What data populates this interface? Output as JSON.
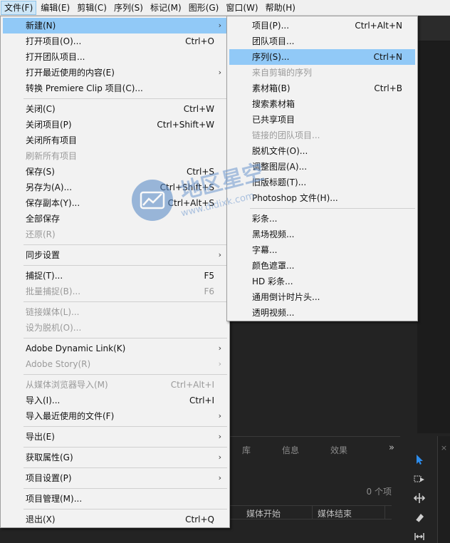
{
  "menubar": {
    "items": [
      "文件(F)",
      "编辑(E)",
      "剪辑(C)",
      "序列(S)",
      "标记(M)",
      "图形(G)",
      "窗口(W)",
      "帮助(H)"
    ]
  },
  "file_menu": {
    "items": [
      {
        "label": "新建(N)",
        "shortcut": ""
      },
      {
        "label": "打开项目(O)...",
        "shortcut": "Ctrl+O"
      },
      {
        "label": "打开团队项目...",
        "shortcut": ""
      },
      {
        "label": "打开最近使用的内容(E)",
        "shortcut": ""
      },
      {
        "label": "转换 Premiere Clip 项目(C)...",
        "shortcut": ""
      },
      {
        "label": "关闭(C)",
        "shortcut": "Ctrl+W"
      },
      {
        "label": "关闭项目(P)",
        "shortcut": "Ctrl+Shift+W"
      },
      {
        "label": "关闭所有项目",
        "shortcut": ""
      },
      {
        "label": "刷新所有项目",
        "shortcut": ""
      },
      {
        "label": "保存(S)",
        "shortcut": "Ctrl+S"
      },
      {
        "label": "另存为(A)...",
        "shortcut": "Ctrl+Shift+S"
      },
      {
        "label": "保存副本(Y)...",
        "shortcut": "Ctrl+Alt+S"
      },
      {
        "label": "全部保存",
        "shortcut": ""
      },
      {
        "label": "还原(R)",
        "shortcut": ""
      },
      {
        "label": "同步设置",
        "shortcut": ""
      },
      {
        "label": "捕捉(T)...",
        "shortcut": "F5"
      },
      {
        "label": "批量捕捉(B)...",
        "shortcut": "F6"
      },
      {
        "label": "链接媒体(L)...",
        "shortcut": ""
      },
      {
        "label": "设为脱机(O)...",
        "shortcut": ""
      },
      {
        "label": "Adobe Dynamic Link(K)",
        "shortcut": ""
      },
      {
        "label": "Adobe Story(R)",
        "shortcut": ""
      },
      {
        "label": "从媒体浏览器导入(M)",
        "shortcut": "Ctrl+Alt+I"
      },
      {
        "label": "导入(I)...",
        "shortcut": "Ctrl+I"
      },
      {
        "label": "导入最近使用的文件(F)",
        "shortcut": ""
      },
      {
        "label": "导出(E)",
        "shortcut": ""
      },
      {
        "label": "获取属性(G)",
        "shortcut": ""
      },
      {
        "label": "项目设置(P)",
        "shortcut": ""
      },
      {
        "label": "项目管理(M)...",
        "shortcut": ""
      },
      {
        "label": "退出(X)",
        "shortcut": "Ctrl+Q"
      }
    ]
  },
  "new_submenu": {
    "items": [
      {
        "label": "项目(P)...",
        "shortcut": "Ctrl+Alt+N"
      },
      {
        "label": "团队项目...",
        "shortcut": ""
      },
      {
        "label": "序列(S)...",
        "shortcut": "Ctrl+N"
      },
      {
        "label": "来自剪辑的序列",
        "shortcut": ""
      },
      {
        "label": "素材箱(B)",
        "shortcut": "Ctrl+B"
      },
      {
        "label": "搜索素材箱",
        "shortcut": ""
      },
      {
        "label": "已共享项目",
        "shortcut": ""
      },
      {
        "label": "链接的团队项目...",
        "shortcut": ""
      },
      {
        "label": "脱机文件(O)...",
        "shortcut": ""
      },
      {
        "label": "调整图层(A)...",
        "shortcut": ""
      },
      {
        "label": "旧版标题(T)...",
        "shortcut": ""
      },
      {
        "label": "Photoshop 文件(H)...",
        "shortcut": ""
      },
      {
        "label": "彩条...",
        "shortcut": ""
      },
      {
        "label": "黑场视频...",
        "shortcut": ""
      },
      {
        "label": "字幕...",
        "shortcut": ""
      },
      {
        "label": "颜色遮罩...",
        "shortcut": ""
      },
      {
        "label": "HD 彩条...",
        "shortcut": ""
      },
      {
        "label": "通用倒计时片头...",
        "shortcut": ""
      },
      {
        "label": "透明视频...",
        "shortcut": ""
      }
    ]
  },
  "bottom_panel": {
    "tabs": [
      "库",
      "信息",
      "效果"
    ],
    "more": "»",
    "item_count": "0 个项",
    "columns": [
      "媒体开始",
      "媒体结束"
    ]
  },
  "watermark": {
    "text": "地区星空",
    "url": "www.didixk.com"
  },
  "colors": {
    "menu_bg": "#f2f2f2",
    "highlight": "#91c9f7",
    "disabled_text": "#9a9a9a",
    "app_bg": "#232323",
    "tool_accent": "#2d8ceb"
  }
}
